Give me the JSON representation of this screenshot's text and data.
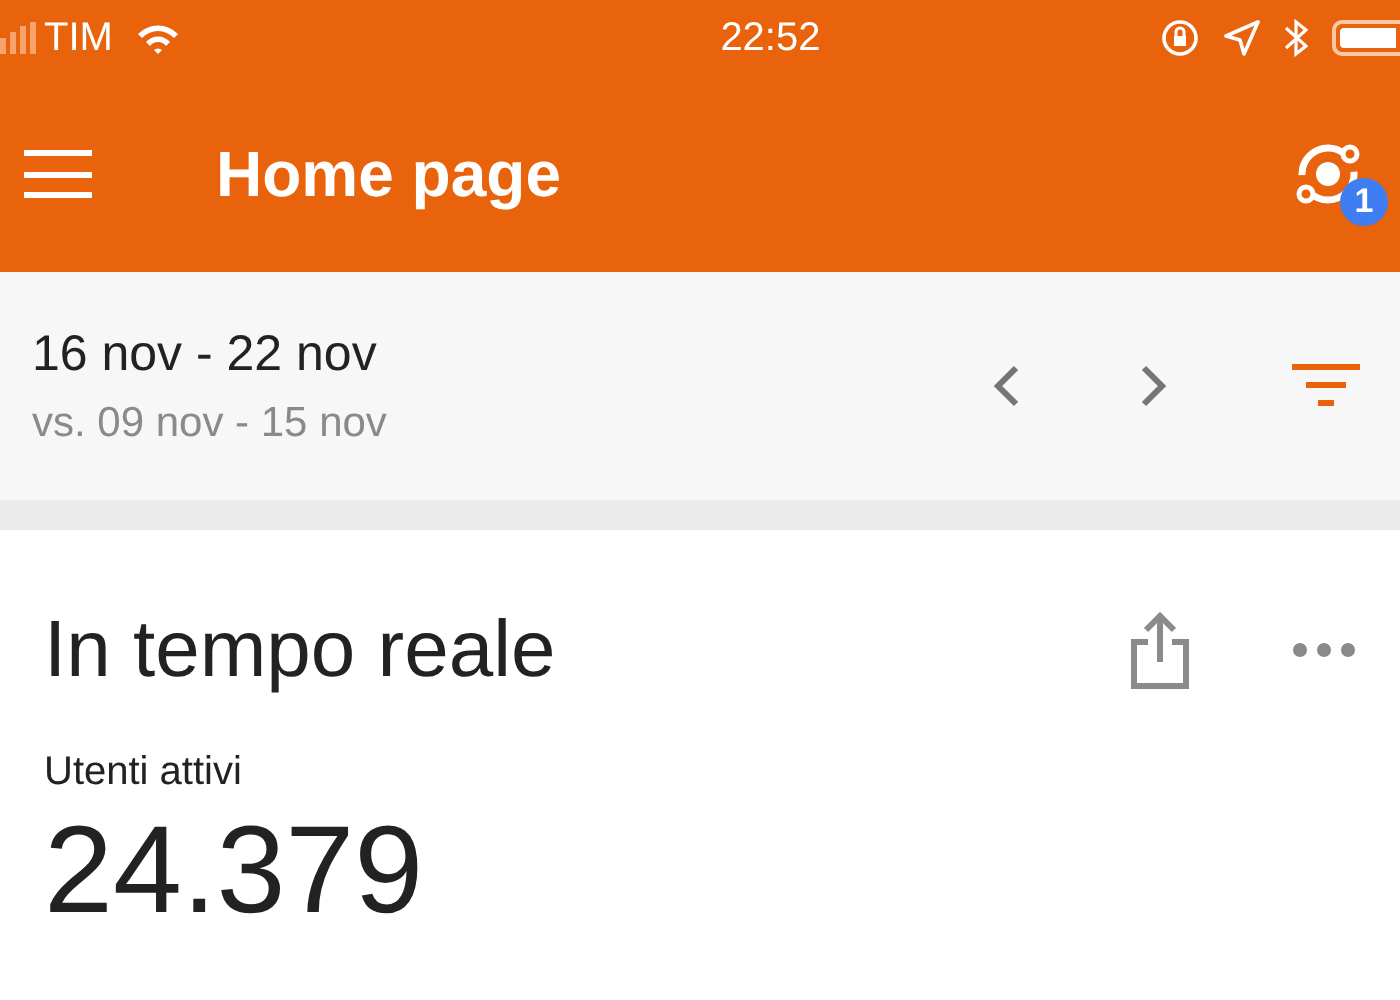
{
  "status_bar": {
    "carrier": "TIM",
    "time": "22:52"
  },
  "app_bar": {
    "title": "Home page",
    "badge": "1"
  },
  "date_bar": {
    "range": "16 nov - 22 nov",
    "comparison": "vs. 09 nov - 15 nov"
  },
  "card": {
    "title": "In tempo reale",
    "metric_label": "Utenti attivi",
    "metric_value": "24.379"
  }
}
